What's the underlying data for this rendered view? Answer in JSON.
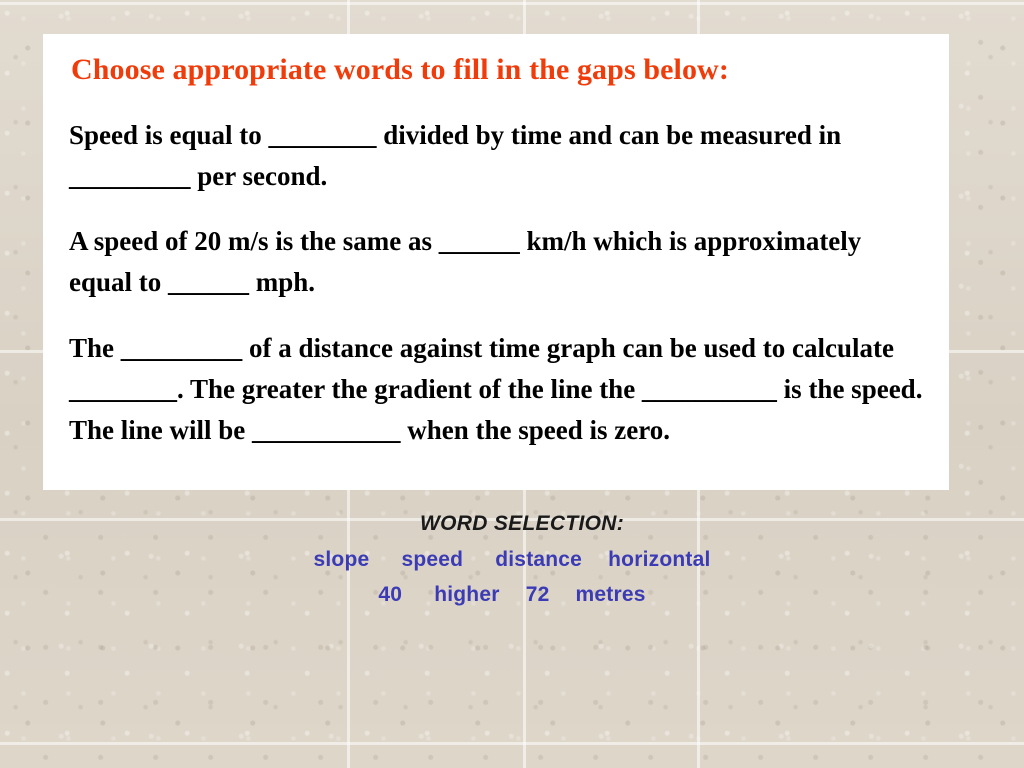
{
  "slide": {
    "title": "Choose appropriate words to fill in the gaps below:",
    "paragraphs": [
      "Speed is equal to ________ divided by time and can be measured in _________ per second.",
      "A speed of 20 m/s is the same as ______ km/h which is approximately equal to ______ mph.",
      "The _________ of a distance against time graph can be used to calculate ________. The greater the gradient of the line the __________ is the speed.  The line will be ___________ when the speed is zero."
    ],
    "word_selection": {
      "heading": "WORD SELECTION:",
      "row1": [
        "slope",
        "speed",
        "distance",
        "horizontal"
      ],
      "row2": [
        "40",
        "higher",
        "72",
        "metres"
      ]
    },
    "colors": {
      "title": "#f03c0a",
      "body": "#000000",
      "word_selection_heading": "#1a1a1a",
      "word_selection_words": "#3b3bb5",
      "card_background": "#ffffff",
      "slide_background": "#ded6c9"
    }
  }
}
